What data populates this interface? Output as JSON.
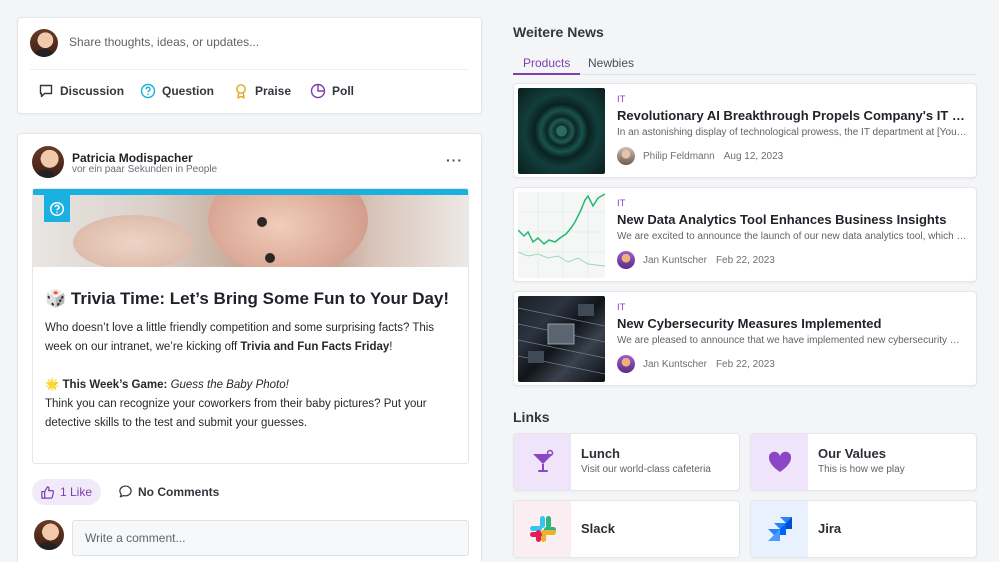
{
  "composer": {
    "placeholder": "Share thoughts, ideas, or updates...",
    "types": [
      {
        "label": "Discussion",
        "icon": "chat-bubble-icon"
      },
      {
        "label": "Question",
        "icon": "question-circle-icon"
      },
      {
        "label": "Praise",
        "icon": "award-ribbon-icon"
      },
      {
        "label": "Poll",
        "icon": "pie-chart-icon"
      }
    ]
  },
  "post": {
    "author": "Patricia Modispacher",
    "meta": "vor ein paar Sekunden in People",
    "more": "···",
    "article": {
      "title": "🎲 Trivia Time: Let’s Bring Some Fun to Your Day!",
      "p1_start": "Who doesn’t love a little friendly competition and some surprising facts? This week on our intranet, we’re kicking off ",
      "p1_bold": "Trivia and Fun Facts Friday",
      "p1_end": "!",
      "game_emoji": "🌟",
      "game_label": "This Week’s Game:",
      "game_name": "Guess the Baby Photo!",
      "p2": "Think you can recognize your coworkers from their baby pictures? Put your detective skills to the test and submit your guesses."
    },
    "like_label": "1 Like",
    "comments_label": "No Comments",
    "comment_placeholder": "Write a comment..."
  },
  "news": {
    "heading": "Weitere News",
    "tabs": [
      "Products",
      "Newbies"
    ],
    "active_tab": "Products",
    "items": [
      {
        "category": "IT",
        "title": "Revolutionary AI Breakthrough Propels Company's IT Department",
        "excerpt": "In an astonishing display of technological prowess, the IT department at [Your Company]",
        "author": "Philip Feldmann",
        "date": "Aug 12, 2023"
      },
      {
        "category": "IT",
        "title": "New Data Analytics Tool Enhances Business Insights",
        "excerpt": "We are excited to announce the launch of our new data analytics tool, which will",
        "author": "Jan Kuntscher",
        "date": "Feb 22, 2023"
      },
      {
        "category": "IT",
        "title": "New Cybersecurity Measures Implemented",
        "excerpt": "We are pleased to announce that we have implemented new cybersecurity measures",
        "author": "Jan Kuntscher",
        "date": "Feb 22, 2023"
      }
    ]
  },
  "links": {
    "heading": "Links",
    "items": [
      {
        "title": "Lunch",
        "subtitle": "Visit our world-class cafeteria",
        "icon": "cocktail-glass-icon"
      },
      {
        "title": "Our Values",
        "subtitle": "This is how we play",
        "icon": "heart-icon"
      },
      {
        "title": "Slack",
        "subtitle": "",
        "icon": "slack-logo-icon"
      },
      {
        "title": "Jira",
        "subtitle": "",
        "icon": "jira-logo-icon"
      }
    ]
  },
  "colors": {
    "accent": "#7b3fb3",
    "article_bar": "#1ab0e0",
    "category": "#8a46c6"
  }
}
